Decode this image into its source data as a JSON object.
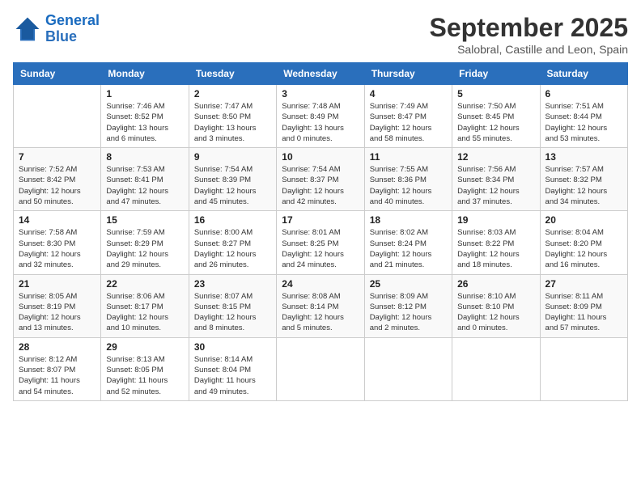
{
  "header": {
    "logo_line1": "General",
    "logo_line2": "Blue",
    "month": "September 2025",
    "location": "Salobral, Castille and Leon, Spain"
  },
  "weekdays": [
    "Sunday",
    "Monday",
    "Tuesday",
    "Wednesday",
    "Thursday",
    "Friday",
    "Saturday"
  ],
  "weeks": [
    [
      {
        "day": "",
        "info": ""
      },
      {
        "day": "1",
        "info": "Sunrise: 7:46 AM\nSunset: 8:52 PM\nDaylight: 13 hours\nand 6 minutes."
      },
      {
        "day": "2",
        "info": "Sunrise: 7:47 AM\nSunset: 8:50 PM\nDaylight: 13 hours\nand 3 minutes."
      },
      {
        "day": "3",
        "info": "Sunrise: 7:48 AM\nSunset: 8:49 PM\nDaylight: 13 hours\nand 0 minutes."
      },
      {
        "day": "4",
        "info": "Sunrise: 7:49 AM\nSunset: 8:47 PM\nDaylight: 12 hours\nand 58 minutes."
      },
      {
        "day": "5",
        "info": "Sunrise: 7:50 AM\nSunset: 8:45 PM\nDaylight: 12 hours\nand 55 minutes."
      },
      {
        "day": "6",
        "info": "Sunrise: 7:51 AM\nSunset: 8:44 PM\nDaylight: 12 hours\nand 53 minutes."
      }
    ],
    [
      {
        "day": "7",
        "info": "Sunrise: 7:52 AM\nSunset: 8:42 PM\nDaylight: 12 hours\nand 50 minutes."
      },
      {
        "day": "8",
        "info": "Sunrise: 7:53 AM\nSunset: 8:41 PM\nDaylight: 12 hours\nand 47 minutes."
      },
      {
        "day": "9",
        "info": "Sunrise: 7:54 AM\nSunset: 8:39 PM\nDaylight: 12 hours\nand 45 minutes."
      },
      {
        "day": "10",
        "info": "Sunrise: 7:54 AM\nSunset: 8:37 PM\nDaylight: 12 hours\nand 42 minutes."
      },
      {
        "day": "11",
        "info": "Sunrise: 7:55 AM\nSunset: 8:36 PM\nDaylight: 12 hours\nand 40 minutes."
      },
      {
        "day": "12",
        "info": "Sunrise: 7:56 AM\nSunset: 8:34 PM\nDaylight: 12 hours\nand 37 minutes."
      },
      {
        "day": "13",
        "info": "Sunrise: 7:57 AM\nSunset: 8:32 PM\nDaylight: 12 hours\nand 34 minutes."
      }
    ],
    [
      {
        "day": "14",
        "info": "Sunrise: 7:58 AM\nSunset: 8:30 PM\nDaylight: 12 hours\nand 32 minutes."
      },
      {
        "day": "15",
        "info": "Sunrise: 7:59 AM\nSunset: 8:29 PM\nDaylight: 12 hours\nand 29 minutes."
      },
      {
        "day": "16",
        "info": "Sunrise: 8:00 AM\nSunset: 8:27 PM\nDaylight: 12 hours\nand 26 minutes."
      },
      {
        "day": "17",
        "info": "Sunrise: 8:01 AM\nSunset: 8:25 PM\nDaylight: 12 hours\nand 24 minutes."
      },
      {
        "day": "18",
        "info": "Sunrise: 8:02 AM\nSunset: 8:24 PM\nDaylight: 12 hours\nand 21 minutes."
      },
      {
        "day": "19",
        "info": "Sunrise: 8:03 AM\nSunset: 8:22 PM\nDaylight: 12 hours\nand 18 minutes."
      },
      {
        "day": "20",
        "info": "Sunrise: 8:04 AM\nSunset: 8:20 PM\nDaylight: 12 hours\nand 16 minutes."
      }
    ],
    [
      {
        "day": "21",
        "info": "Sunrise: 8:05 AM\nSunset: 8:19 PM\nDaylight: 12 hours\nand 13 minutes."
      },
      {
        "day": "22",
        "info": "Sunrise: 8:06 AM\nSunset: 8:17 PM\nDaylight: 12 hours\nand 10 minutes."
      },
      {
        "day": "23",
        "info": "Sunrise: 8:07 AM\nSunset: 8:15 PM\nDaylight: 12 hours\nand 8 minutes."
      },
      {
        "day": "24",
        "info": "Sunrise: 8:08 AM\nSunset: 8:14 PM\nDaylight: 12 hours\nand 5 minutes."
      },
      {
        "day": "25",
        "info": "Sunrise: 8:09 AM\nSunset: 8:12 PM\nDaylight: 12 hours\nand 2 minutes."
      },
      {
        "day": "26",
        "info": "Sunrise: 8:10 AM\nSunset: 8:10 PM\nDaylight: 12 hours\nand 0 minutes."
      },
      {
        "day": "27",
        "info": "Sunrise: 8:11 AM\nSunset: 8:09 PM\nDaylight: 11 hours\nand 57 minutes."
      }
    ],
    [
      {
        "day": "28",
        "info": "Sunrise: 8:12 AM\nSunset: 8:07 PM\nDaylight: 11 hours\nand 54 minutes."
      },
      {
        "day": "29",
        "info": "Sunrise: 8:13 AM\nSunset: 8:05 PM\nDaylight: 11 hours\nand 52 minutes."
      },
      {
        "day": "30",
        "info": "Sunrise: 8:14 AM\nSunset: 8:04 PM\nDaylight: 11 hours\nand 49 minutes."
      },
      {
        "day": "",
        "info": ""
      },
      {
        "day": "",
        "info": ""
      },
      {
        "day": "",
        "info": ""
      },
      {
        "day": "",
        "info": ""
      }
    ]
  ]
}
